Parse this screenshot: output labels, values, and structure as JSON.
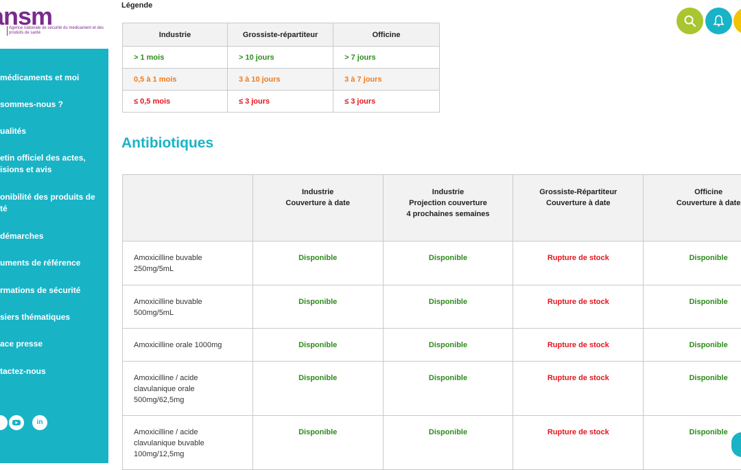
{
  "logo": {
    "word": "ansm",
    "subtitle": "Agence nationale de sécurité du médicament et des produits de santé"
  },
  "nav": [
    "médicaments et moi",
    "sommes-nous ?",
    "ualités",
    "etin officiel des actes,",
    "isions et avis",
    "onibilité des produits de",
    "té",
    "démarches",
    "uments de référence",
    "rmations de sécurité",
    "siers thématiques",
    "ace presse",
    "tactez-nous"
  ],
  "social": [
    "youtube-icon",
    "linkedin-icon"
  ],
  "social_text": {
    "linkedin": "in"
  },
  "top_buttons": {
    "search_color": "#a9c52f",
    "alert_color": "#19b3c6",
    "extra_color": "#f5c400"
  },
  "legend": {
    "title": "Légende",
    "headers": [
      "Industrie",
      "Grossiste-répartiteur",
      "Officine"
    ],
    "rows": [
      [
        "> 1 mois",
        "> 10 jours",
        "> 7 jours"
      ],
      [
        "0,5 à 1 mois",
        "3 à 10 jours",
        "3 à 7 jours"
      ],
      [
        "≤ 0,5 mois",
        "≤ 3 jours",
        "≤ 3 jours"
      ]
    ]
  },
  "section_title": "Antibiotiques",
  "antibiotiques": {
    "headers": [
      "",
      "Industrie\nCouverture à date",
      "Industrie\nProjection couverture\n4 prochaines semaines",
      "Grossiste-Répartiteur\nCouverture à date",
      "Officine\nCouverture à date"
    ],
    "rows": [
      {
        "product": "Amoxicilline buvable\n250mg/5mL",
        "status": [
          "Disponible",
          "Disponible",
          "Rupture de stock",
          "Disponible"
        ]
      },
      {
        "product": "Amoxicilline buvable\n500mg/5mL",
        "status": [
          "Disponible",
          "Disponible",
          "Rupture de stock",
          "Disponible"
        ]
      },
      {
        "product": "Amoxicilline orale 1000mg",
        "status": [
          "Disponible",
          "Disponible",
          "Rupture de stock",
          "Disponible"
        ]
      },
      {
        "product": "Amoxicilline / acide\nclavulanique orale\n500mg/62,5mg",
        "status": [
          "Disponible",
          "Disponible",
          "Rupture de stock",
          "Disponible"
        ]
      },
      {
        "product": "Amoxicilline / acide\nclavulanique buvable\n100mg/12,5mg",
        "status": [
          "Disponible",
          "Disponible",
          "Rupture de stock",
          "Disponible"
        ]
      }
    ]
  },
  "colors": {
    "sidebar": "#19b3c6",
    "green": "#2e8b1c",
    "orange": "#f07a1c",
    "red": "#e5141c",
    "logo": "#7a2a8c"
  }
}
